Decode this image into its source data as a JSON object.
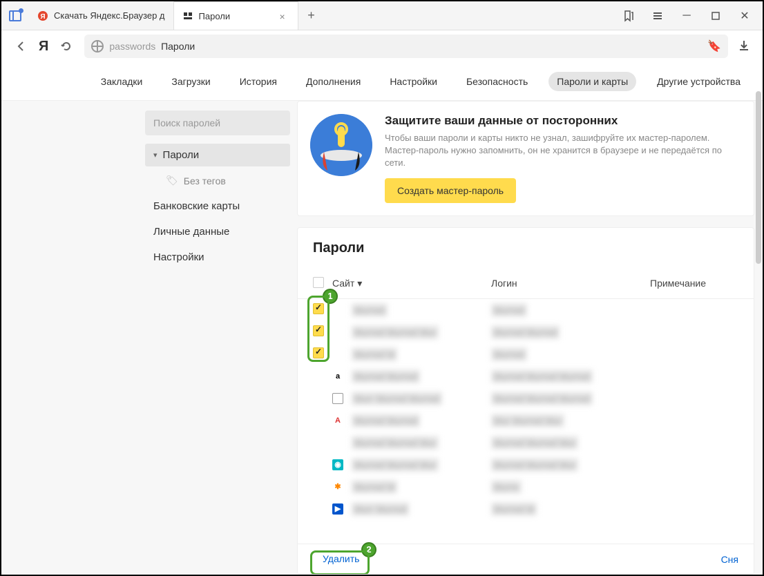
{
  "tabs": [
    {
      "title": "Скачать Яндекс.Браузер д",
      "icon_color": "#e4472e"
    },
    {
      "title": "Пароли",
      "active": true
    }
  ],
  "url": {
    "path": "passwords",
    "label": "Пароли"
  },
  "settings_nav": [
    "Закладки",
    "Загрузки",
    "История",
    "Дополнения",
    "Настройки",
    "Безопасность",
    "Пароли и карты",
    "Другие устройства"
  ],
  "settings_nav_active": 6,
  "sidebar": {
    "search_placeholder": "Поиск паролей",
    "items": [
      {
        "label": "Пароли",
        "active": true,
        "chevron": true
      },
      {
        "label": "Без тегов",
        "sub": true
      },
      {
        "label": "Банковские карты"
      },
      {
        "label": "Личные данные"
      },
      {
        "label": "Настройки"
      }
    ]
  },
  "banner": {
    "title": "Защитите ваши данные от посторонних",
    "text": "Чтобы ваши пароли и карты никто не узнал, зашифруйте их мастер-паролем. Мастер-пароль нужно запомнить, он не хранится в браузере и не передаётся по сети.",
    "button": "Создать мастер-пароль"
  },
  "panel": {
    "title": "Пароли",
    "columns": {
      "site": "Сайт",
      "login": "Логин",
      "note": "Примечание"
    },
    "rows": [
      {
        "checked": true,
        "icon_bg": "#fff",
        "icon_txt": "",
        "site": "blurred",
        "login": "blurred"
      },
      {
        "checked": true,
        "icon_bg": "#fff",
        "icon_txt": "",
        "site": "blurred blurred blur",
        "login": "blurred blurred"
      },
      {
        "checked": true,
        "icon_bg": "#fff",
        "icon_txt": "",
        "site": "blurred bl",
        "login": "blurred"
      },
      {
        "checked": false,
        "icon": "amazon",
        "site": "blurred blurred",
        "login": "blurred blurred blurred"
      },
      {
        "checked": false,
        "icon": "doc",
        "site": "blurr blurred blurred",
        "login": "blurred blurred blurred"
      },
      {
        "checked": false,
        "icon": "adobe",
        "site": "blurred blurred",
        "login": "blur blurred blur"
      },
      {
        "checked": false,
        "icon": "blank",
        "site": "blurred blurred blur",
        "login": "blurred blurred blur"
      },
      {
        "checked": false,
        "icon": "teal",
        "site": "blurred blurred blur",
        "login": "blurred blurred blur"
      },
      {
        "checked": false,
        "icon": "avast",
        "site": "blurred bl",
        "login": "blurre"
      },
      {
        "checked": false,
        "icon": "blue",
        "site": "blurr blurred",
        "login": "blurred bl"
      }
    ],
    "delete": "Удалить",
    "clear": "Сня"
  },
  "badges": {
    "one": "1",
    "two": "2"
  }
}
